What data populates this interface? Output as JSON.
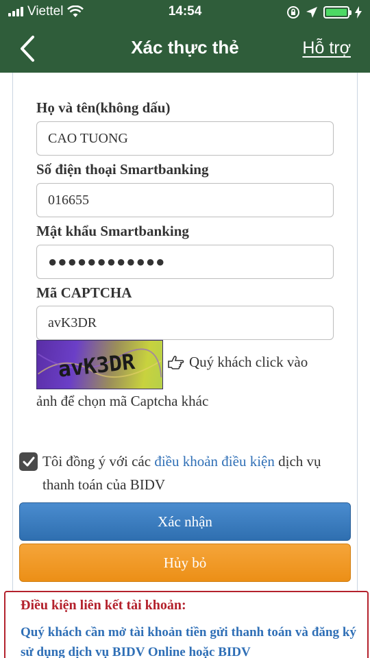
{
  "status_bar": {
    "carrier": "Viettel",
    "time": "14:54",
    "battery_color": "#4cd964"
  },
  "header": {
    "back_icon": "chevron-left-icon",
    "title": "Xác thực thẻ",
    "support_link": "Hỗ trợ",
    "background_color": "#2f5d3a"
  },
  "form": {
    "full_name": {
      "label": "Họ và tên(không dấu)",
      "value": "CAO TUONG"
    },
    "phone": {
      "label": "Số điện thoại Smartbanking",
      "value": "016655"
    },
    "password": {
      "label": "Mật khẩu Smartbanking",
      "value": "●●●●●●●●●●●●"
    },
    "captcha": {
      "label": "Mã CAPTCHA",
      "value": "avK3DR",
      "image_text": "avK3DR"
    },
    "captcha_hint_line1": "Quý khách click vào",
    "captcha_hint_line2": "ảnh để chọn mã Captcha khác"
  },
  "agreement": {
    "checked": true,
    "text_before": "Tôi đồng ý với các ",
    "link_text": "điều khoản điều kiện",
    "text_after": " dịch vụ thanh toán của BIDV"
  },
  "buttons": {
    "confirm": "Xác nhận",
    "cancel": "Hủy bỏ",
    "confirm_color": "#3a7fc4",
    "cancel_color": "#f09a26"
  },
  "terms": {
    "title": "Điều kiện liên kết tài khoản:",
    "body": "Quý khách cần mở tài khoản tiền gửi thanh toán và đăng ký sử dụng dịch vụ BIDV Online hoặc BIDV",
    "title_color": "#b3212c",
    "body_color": "#2f6fb6"
  }
}
